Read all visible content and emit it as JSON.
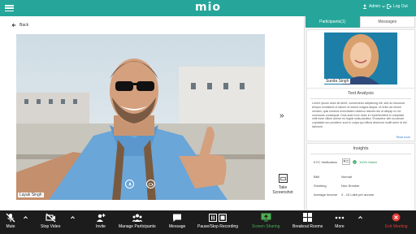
{
  "app": {
    "logo": "mio"
  },
  "topbar": {
    "admin_label": "Admin",
    "logout_label": "Log Out"
  },
  "main": {
    "back_label": "Back",
    "participant_name": "Layak Singh",
    "screenshot_label_1": "Take",
    "screenshot_label_2": "Screenshot"
  },
  "sidebar": {
    "tabs": [
      {
        "label": "Participants(1)",
        "active": true
      },
      {
        "label": "Messages",
        "active": false
      }
    ],
    "profile_name": "Sunita Singh",
    "text_analysis": {
      "title": "Text Analysis",
      "body": "Lorem ipsum dolor sit amet, consectetur adipiscing elit, sed do eiusmod tempor incididunt ut labore et dolore magna aliqua. Ut enim ad minim veniam, quis nostrud exercitation ullamco laboris nisi ut aliquip ex ea commodo consequat. Duis aute irure dolor in reprehenderit in voluptate velit esse cillum dolore eu fugiat nulla pariatur. Excepteur sint occaecat cupidatat non proident, sunt in culpa qui officia deserunt mollit anim id est laborum.",
      "read_more": "Read more"
    },
    "insights": {
      "title": "Insights",
      "rows": [
        {
          "label": "KYC Verification",
          "value": "100% Match"
        },
        {
          "label": "BMI",
          "value": "Normal"
        },
        {
          "label": "Smoking",
          "value": "Non-Smoker"
        },
        {
          "label": "Average Income",
          "value": "3 - 10 Lakh per annum"
        }
      ],
      "read_more": "Read more"
    }
  },
  "toolbar": {
    "items": [
      {
        "label": "Mute",
        "icon": "mic-off-icon"
      },
      {
        "label": "Stop Video",
        "icon": "video-off-icon"
      },
      {
        "label": "Invite",
        "icon": "add-person-icon"
      },
      {
        "label": "Manage Participants",
        "icon": "participants-icon"
      },
      {
        "label": "Message",
        "icon": "chat-icon"
      },
      {
        "label": "Pause/Stop Recording",
        "icon": "record-icon"
      },
      {
        "label": "Screen Sharing",
        "icon": "screen-share-icon"
      },
      {
        "label": "Breakout Rooms",
        "icon": "grid-icon"
      },
      {
        "label": "More",
        "icon": "more-icon"
      },
      {
        "label": "Exit Meeting",
        "icon": "exit-icon"
      }
    ]
  },
  "colors": {
    "brand": "#26a69a",
    "toolbar_bg": "#1c1c1c",
    "screen_share": "#4caf50",
    "exit": "#e53935",
    "verified": "#2e9e5b"
  }
}
